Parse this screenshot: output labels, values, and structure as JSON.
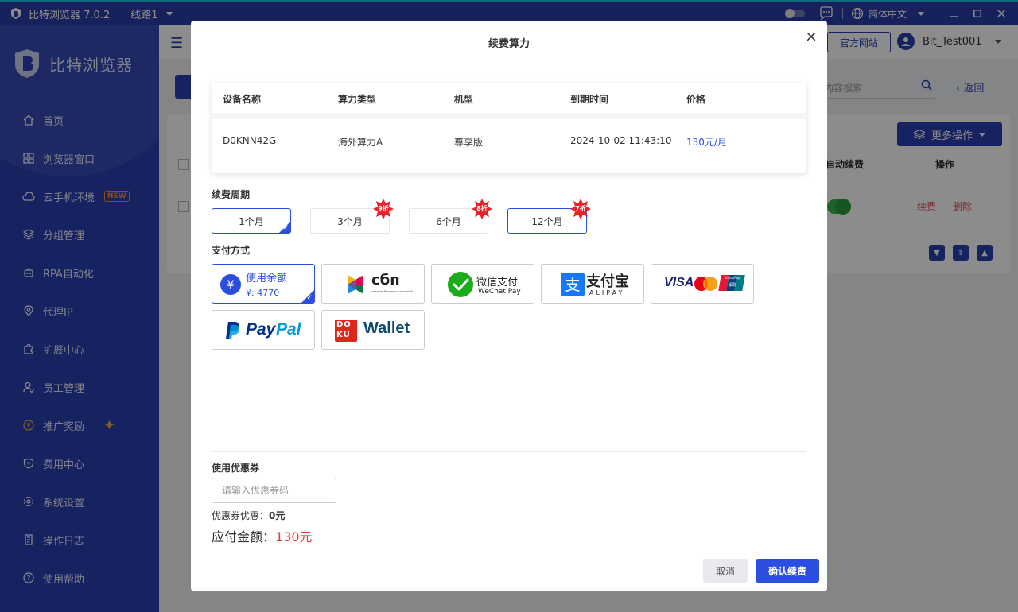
{
  "app": {
    "title": "比特浏览器 7.0.2",
    "line": "线路1",
    "language": "简体中文"
  },
  "sidebar": {
    "brand": "比特浏览器",
    "items": [
      {
        "label": "首页",
        "icon": "home-icon"
      },
      {
        "label": "浏览器窗口",
        "icon": "grid-icon"
      },
      {
        "label": "云手机环境",
        "icon": "cloud-icon",
        "badge": "NEW"
      },
      {
        "label": "分组管理",
        "icon": "layers-icon"
      },
      {
        "label": "RPA自动化",
        "icon": "robot-icon"
      },
      {
        "label": "代理IP",
        "icon": "location-icon"
      },
      {
        "label": "扩展中心",
        "icon": "puzzle-icon"
      },
      {
        "label": "员工管理",
        "icon": "staff-icon"
      },
      {
        "label": "推广奖励",
        "icon": "reward-icon"
      },
      {
        "label": "费用中心",
        "icon": "shield-icon"
      },
      {
        "label": "系统设置",
        "icon": "settings-icon"
      },
      {
        "label": "操作日志",
        "icon": "log-icon"
      },
      {
        "label": "使用帮助",
        "icon": "help-icon"
      }
    ]
  },
  "header": {
    "official_site": "官方网站",
    "username": "Bit_Test001"
  },
  "background": {
    "search_placeholder": "内容搜索",
    "back": "返回",
    "more_ops": "更多操作",
    "col_auto_renew": "自动续费",
    "col_ops": "操作",
    "row_renew": "续费",
    "row_delete": "删除"
  },
  "modal": {
    "title": "续费算力",
    "table": {
      "headers": [
        "设备名称",
        "算力类型",
        "机型",
        "到期时间",
        "价格"
      ],
      "row": [
        "D0KNN42G",
        "海外算力A",
        "尊享版",
        "2024-10-02 11:43:10",
        "130元/月"
      ]
    },
    "period_label": "续费周期",
    "periods": [
      {
        "label": "1个月",
        "selected": true,
        "badge": ""
      },
      {
        "label": "3个月",
        "selected": false,
        "badge": "9折"
      },
      {
        "label": "6个月",
        "selected": false,
        "badge": "8折"
      },
      {
        "label": "12个月",
        "selected": false,
        "badge": "7折"
      }
    ],
    "payment_label": "支付方式",
    "balance": {
      "label": "使用余额",
      "amount": "¥: 4770"
    },
    "payments": {
      "sbp": "сбп",
      "sbp_sub": "система быстрых платежей",
      "wechat": "微信支付",
      "wechat_sub": "WeChat Pay",
      "alipay": "支付宝",
      "alipay_sub": "ALIPAY",
      "visa": "VISA",
      "unionpay": "UnionPay",
      "unionpay_cn": "银联",
      "paypal_a": "Pay",
      "paypal_b": "Pal",
      "doku": "Wallet",
      "doku_logo_top": "DO",
      "doku_logo_bottom": "KU"
    },
    "coupon_label": "使用优惠券",
    "coupon_placeholder": "请输入优惠券码",
    "coupon_discount_label": "优惠券优惠：",
    "coupon_discount_value": "0元",
    "payable_label": "应付金额：",
    "payable_value": "130元",
    "cancel": "取消",
    "confirm": "确认续费"
  },
  "colors": {
    "sidebar": "#2b3fb0",
    "primary": "#2b4ee0",
    "price": "#e53935",
    "badge": "#e8232a"
  }
}
